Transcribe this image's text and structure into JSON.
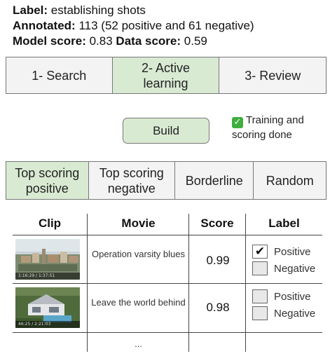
{
  "info": {
    "label_key": "Label:",
    "label_value": "establishing shots",
    "annotated_key": "Annotated:",
    "annotated_value": "113 (52 positive and 61 negative)",
    "model_score_key": "Model score:",
    "model_score_value": "0.83",
    "data_score_key": "Data score:",
    "data_score_value": "0.59"
  },
  "steps": [
    {
      "label": "1- Search",
      "active": false
    },
    {
      "label": "2- Active learning",
      "active": true
    },
    {
      "label": "3- Review",
      "active": false
    }
  ],
  "build_button": "Build",
  "status": {
    "icon": "check-mark-icon",
    "text": "Training and scoring done",
    "color": "#3fae3f"
  },
  "filters": [
    {
      "label": "Top scoring positive",
      "active": true
    },
    {
      "label": "Top scoring negative",
      "active": false
    },
    {
      "label": "Borderline",
      "active": false
    },
    {
      "label": "Random",
      "active": false
    }
  ],
  "table": {
    "headers": {
      "clip": "Clip",
      "movie": "Movie",
      "score": "Score",
      "label": "Label"
    },
    "rows": [
      {
        "thumbnail": "city-aerial-thumbnail",
        "timecode": "1:16:29 / 1:37:51",
        "movie": "Operation varsity blues",
        "score": "0.99",
        "positive_label": "Positive",
        "negative_label": "Negative",
        "positive_checked": true,
        "negative_checked": false
      },
      {
        "thumbnail": "house-pool-thumbnail",
        "timecode": "46:25 / 2:21:03",
        "movie": "Leave the world behind",
        "score": "0.98",
        "positive_label": "Positive",
        "negative_label": "Negative",
        "positive_checked": false,
        "negative_checked": false
      }
    ],
    "more": "..."
  },
  "colors": {
    "active_bg": "#d9ead3",
    "inactive_bg": "#f3f3f3",
    "border": "#777777"
  }
}
